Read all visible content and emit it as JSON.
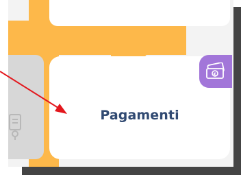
{
  "card": {
    "label": "Pagamenti",
    "icon": "money-icon"
  },
  "left_card": {
    "icon": "document-icon"
  },
  "colors": {
    "orange": "#fdb84a",
    "background": "#f3f3f3",
    "card": "#ffffff",
    "left_card": "#d7d7d7",
    "badge": "#a276d9",
    "label": "#314a72",
    "annotation_arrow": "#e3171d",
    "frame_shadow": "#444444"
  },
  "annotation": {
    "type": "arrow",
    "points_to": "payments-card"
  }
}
